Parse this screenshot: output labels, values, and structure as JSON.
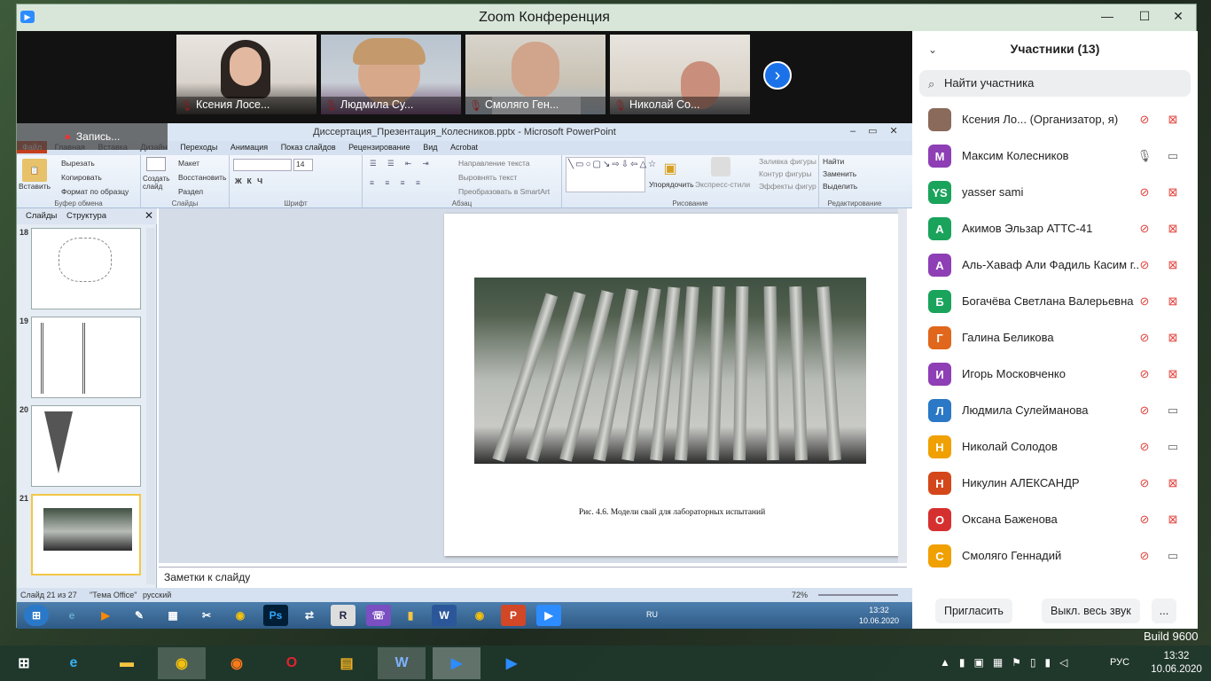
{
  "zoom": {
    "title": "Zoom Конференция",
    "min": "—",
    "max": "☐",
    "close": "✕"
  },
  "video_tiles": [
    {
      "name": "Ксения Лосе..."
    },
    {
      "name": "Людмила Су..."
    },
    {
      "name": "Смоляго Ген..."
    },
    {
      "name": "Николай Со..."
    }
  ],
  "recording_label": "Запись...",
  "ppt": {
    "title": "Диссертация_Презентация_Колесников.pptx - Microsoft PowerPoint",
    "tabs": [
      "Файл",
      "Главная",
      "Вставка",
      "Дизайн",
      "Переходы",
      "Анимация",
      "Показ слайдов",
      "Рецензирование",
      "Вид",
      "Acrobat"
    ],
    "ribbon": {
      "paste": "Вставить",
      "cut": "Вырезать",
      "copy": "Копировать",
      "format_painter": "Формат по образцу",
      "clipboard": "Буфер обмена",
      "new_slide": "Создать слайд",
      "layout": "Макет",
      "reset": "Восстановить",
      "section": "Раздел",
      "slides": "Слайды",
      "font_size": "14",
      "font_group": "Шрифт",
      "text_direction": "Направление текста",
      "align_text": "Выровнять текст",
      "smartart": "Преобразовать в SmartArt",
      "paragraph": "Абзац",
      "arrange": "Упорядочить",
      "quick_styles": "Экспресс-стили",
      "shape_fill": "Заливка фигуры",
      "shape_outline": "Контур фигуры",
      "shape_effects": "Эффекты фигур",
      "drawing": "Рисование",
      "find": "Найти",
      "replace": "Заменить",
      "select": "Выделить",
      "editing": "Редактирование"
    },
    "panel_tabs": [
      "Слайды",
      "Структура"
    ],
    "thumbs": [
      {
        "num": "18"
      },
      {
        "num": "19"
      },
      {
        "num": "20"
      },
      {
        "num": "21"
      }
    ],
    "caption": "Рис. 4.6. Модели свай для лабораторных испытаний",
    "notes": "Заметки к слайду",
    "status": {
      "slide": "Слайд 21 из 27",
      "theme": "\"Тема Office\"",
      "lang": "русский",
      "zoom": "72%"
    }
  },
  "inner_taskbar": {
    "lang": "RU",
    "time": "13:32",
    "date": "10.06.2020"
  },
  "participants": {
    "header": "Участники (13)",
    "search_placeholder": "Найти участника",
    "list": [
      {
        "name": "Ксения Ло...  (Организатор, я)",
        "initial": "",
        "color": "#8a6a5a",
        "mic": "muted",
        "video": "off"
      },
      {
        "name": "Максим Колесников",
        "initial": "М",
        "color": "#8e3fb5",
        "mic": "on",
        "video": "on"
      },
      {
        "name": "yasser sami",
        "initial": "YS",
        "color": "#1aa35b",
        "mic": "muted",
        "video": "off"
      },
      {
        "name": "Акимов Эльзар АТТС-41",
        "initial": "А",
        "color": "#1aa35b",
        "mic": "muted",
        "video": "off"
      },
      {
        "name": "Аль-Хаваф Али Фадиль Касим г...",
        "initial": "А",
        "color": "#8e3fb5",
        "mic": "muted",
        "video": "off"
      },
      {
        "name": "Богачёва Светлана Валерьевна",
        "initial": "Б",
        "color": "#1aa35b",
        "mic": "muted",
        "video": "off"
      },
      {
        "name": "Галина Беликова",
        "initial": "Г",
        "color": "#e0671c",
        "mic": "muted",
        "video": "off"
      },
      {
        "name": "Игорь Московченко",
        "initial": "И",
        "color": "#8e3fb5",
        "mic": "muted",
        "video": "off"
      },
      {
        "name": "Людмила Сулейманова",
        "initial": "Л",
        "color": "#2a78c6",
        "mic": "muted",
        "video": "on"
      },
      {
        "name": "Николай Солодов",
        "initial": "Н",
        "color": "#f0a000",
        "mic": "muted",
        "video": "on"
      },
      {
        "name": "Никулин АЛЕКСАНДР",
        "initial": "Н",
        "color": "#d4471a",
        "mic": "muted",
        "video": "off"
      },
      {
        "name": "Оксана Баженова",
        "initial": "О",
        "color": "#d62f2f",
        "mic": "muted",
        "video": "off"
      },
      {
        "name": "Смоляго Геннадий",
        "initial": "С",
        "color": "#f0a000",
        "mic": "muted",
        "video": "on"
      }
    ],
    "invite": "Пригласить",
    "mute_all": "Выкл. весь звук",
    "more": "..."
  },
  "taskbar": {
    "lang": "РУС",
    "time": "13:32",
    "date": "10.06.2020"
  },
  "watermark": "Build 9600"
}
